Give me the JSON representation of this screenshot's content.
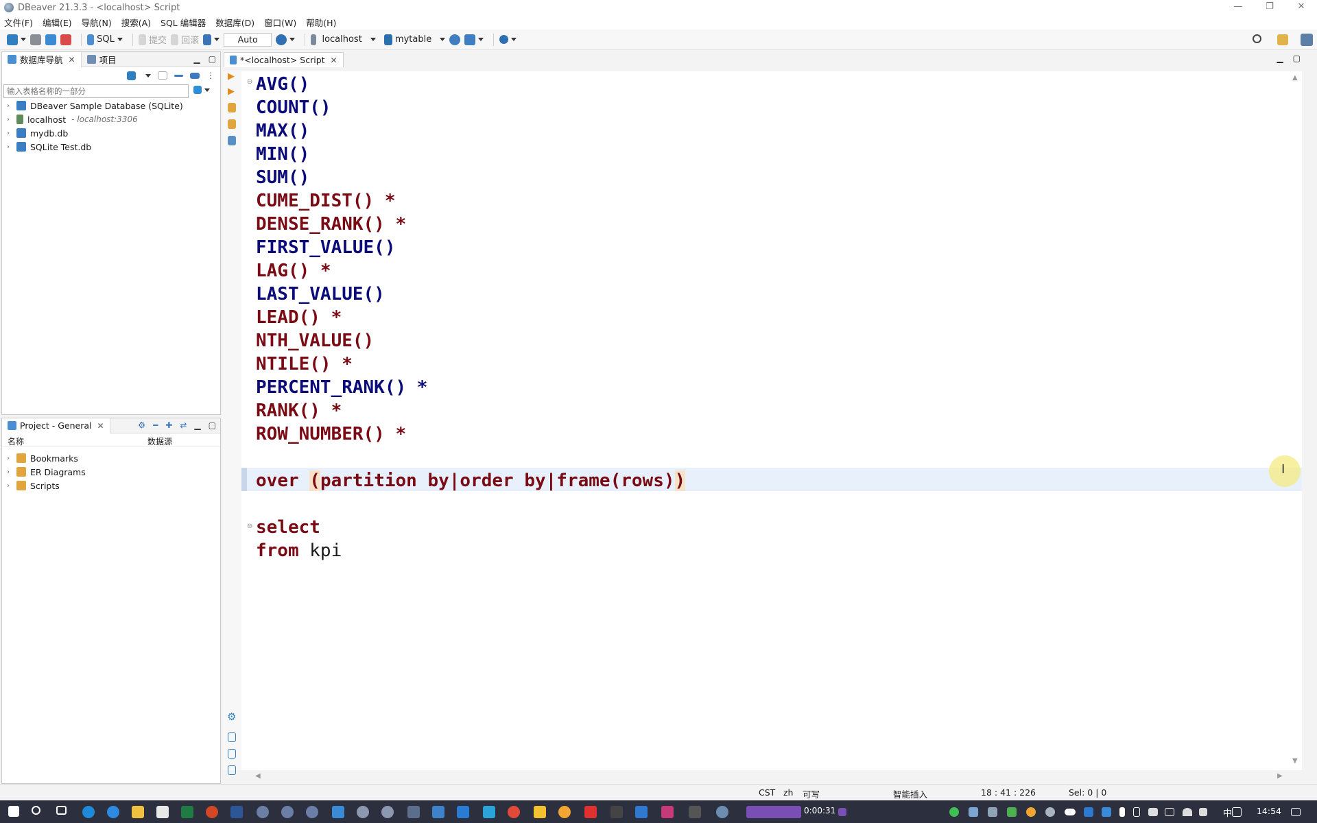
{
  "window": {
    "title": "DBeaver 21.3.3 - <localhost> Script"
  },
  "menu": [
    "文件(F)",
    "编辑(E)",
    "导航(N)",
    "搜索(A)",
    "SQL 编辑器",
    "数据库(D)",
    "窗口(W)",
    "帮助(H)"
  ],
  "toolbar": {
    "sql_label": "SQL",
    "commit_label": "提交",
    "rollback_label": "回滚",
    "auto_label": "Auto",
    "datasource_label": "localhost",
    "schema_label": "mytable"
  },
  "db_navigator": {
    "tab_label": "数据库导航",
    "projects_tab_label": "项目",
    "search_placeholder": "输入表格名称的一部分",
    "items": [
      {
        "label": "DBeaver Sample Database (SQLite)",
        "sub": "",
        "icon": "database-icon"
      },
      {
        "label": "localhost",
        "sub": "- localhost:3306",
        "icon": "mysql-icon"
      },
      {
        "label": "mydb.db",
        "sub": "",
        "icon": "database-icon"
      },
      {
        "label": "SQLite Test.db",
        "sub": "",
        "icon": "database-icon"
      }
    ]
  },
  "project_panel": {
    "tab_label": "Project - General",
    "col_name": "名称",
    "col_datasource": "数据源",
    "items": [
      {
        "label": "Bookmarks"
      },
      {
        "label": "ER Diagrams"
      },
      {
        "label": "Scripts"
      }
    ]
  },
  "editor": {
    "tab_label": "*<localhost> Script",
    "lines": [
      {
        "text": "AVG()",
        "color": "blue"
      },
      {
        "text": "COUNT()",
        "color": "blue"
      },
      {
        "text": "MAX()",
        "color": "blue"
      },
      {
        "text": "MIN()",
        "color": "blue"
      },
      {
        "text": "SUM()",
        "color": "blue"
      },
      {
        "text": "CUME_DIST() *",
        "color": "red"
      },
      {
        "text": "DENSE_RANK() *",
        "color": "red"
      },
      {
        "text": "FIRST_VALUE()",
        "color": "blue"
      },
      {
        "text": "LAG() *",
        "color": "red"
      },
      {
        "text": "LAST_VALUE()",
        "color": "blue"
      },
      {
        "text": "LEAD() *",
        "color": "red"
      },
      {
        "text": "NTH_VALUE()",
        "color": "red"
      },
      {
        "text": "NTILE() *",
        "color": "red"
      },
      {
        "text": "PERCENT_RANK() *",
        "color": "blue"
      },
      {
        "text": "RANK() *",
        "color": "red"
      },
      {
        "text": "ROW_NUMBER() *",
        "color": "red"
      }
    ],
    "over_line": {
      "kw": "over",
      "rest": "(partition by|order by|frame(rows))"
    },
    "select_kw": "select",
    "from_kw": "from",
    "from_rest": "kpi"
  },
  "status": {
    "timezone": "CST",
    "locale": "zh",
    "writable": "可写",
    "insert_mode": "智能插入",
    "position": "18 : 41 : 226",
    "selection": "Sel: 0 | 0"
  },
  "taskbar": {
    "recording_time": "0:00:31",
    "ime": "中",
    "clock": "14:54"
  },
  "colors": {
    "keyword_blue": "#0b0b7a",
    "keyword_red": "#7a0b14",
    "current_line": "#e8f0fb",
    "taskbar": "#2c2f3e"
  }
}
